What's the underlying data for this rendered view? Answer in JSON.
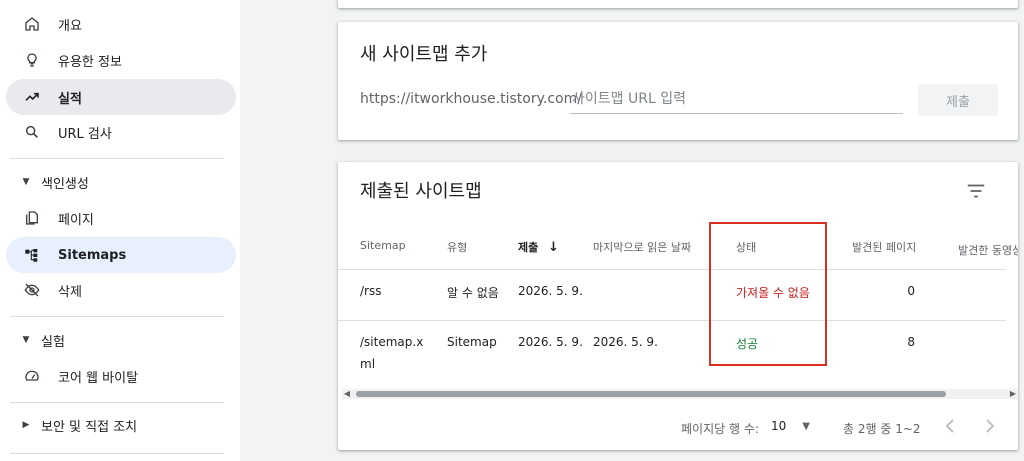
{
  "sidebar": {
    "items": [
      {
        "label": "개요",
        "icon": "home-icon"
      },
      {
        "label": "유용한 정보",
        "icon": "lightbulb-icon"
      },
      {
        "label": "실적",
        "icon": "trending-up-icon"
      },
      {
        "label": "URL 검사",
        "icon": "search-icon"
      }
    ],
    "section_index": {
      "label": "색인생성",
      "caret": "▼"
    },
    "index_items": [
      {
        "label": "페이지",
        "icon": "pages-icon"
      },
      {
        "label": "Sitemaps",
        "icon": "sitemap-icon"
      },
      {
        "label": "삭제",
        "icon": "visibility-off-icon"
      }
    ],
    "section_experiment": {
      "label": "실험",
      "caret": "▼"
    },
    "experiment_items": [
      {
        "label": "코어 웹 바이탈",
        "icon": "speed-gauge-icon"
      }
    ],
    "section_security": {
      "label": "보안 및 직접 조치",
      "caret": "▶"
    }
  },
  "add_sitemap": {
    "title": "새 사이트맵 추가",
    "url_prefix": "https://itworkhouse.tistory.com/",
    "placeholder": "사이트맵 URL 입력",
    "submit_label": "제출"
  },
  "submitted": {
    "title": "제출된 사이트맵",
    "columns": {
      "sitemap": "Sitemap",
      "type": "유형",
      "submitted": "제출",
      "sort_arrow": "↓",
      "last_read": "마지막으로 읽은 날짜",
      "status": "상태",
      "discovered_pages": "발견된 페이지",
      "discovered_videos": "발견한 동영상"
    },
    "rows": [
      {
        "sitemap_line1": "/rss",
        "sitemap_line2": "",
        "type": "알 수 없음",
        "submitted": "2026. 5. 9.",
        "last_read": "",
        "status": "가져올 수 없음",
        "pages": "0"
      },
      {
        "sitemap_line1": "/sitemap.x",
        "sitemap_line2": "ml",
        "type": "Sitemap",
        "submitted": "2026. 5. 9.",
        "last_read": "2026. 5. 9.",
        "status": "성공",
        "pages": "8"
      }
    ],
    "pagination": {
      "rows_per_page_label": "페이지당 행 수:",
      "rows_per_page": "10",
      "range": "총 2행 중 1~2"
    }
  },
  "colors": {
    "status_error": "#c5221f",
    "status_success": "#188038",
    "highlight_box": "#d93025",
    "selected_blue": "#e8f0fe"
  }
}
